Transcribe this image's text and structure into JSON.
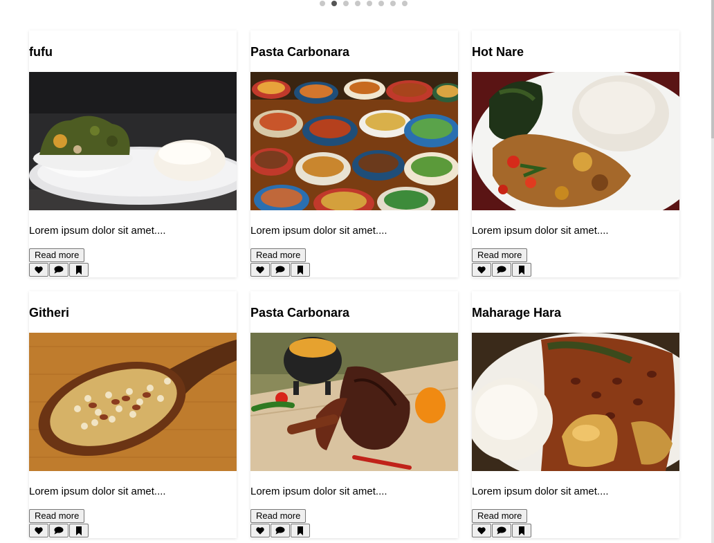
{
  "carousel": {
    "total": 8,
    "active_index": 1
  },
  "cards": [
    {
      "title": "fufu",
      "description": "Lorem ipsum dolor sit amet....",
      "read_more": "Read more",
      "image": "fufu-with-greens-photo"
    },
    {
      "title": "Pasta Carbonara",
      "description": "Lorem ipsum dolor sit amet....",
      "read_more": "Read more",
      "image": "african-food-spread-photo"
    },
    {
      "title": "Hot Nare",
      "description": "Lorem ipsum dolor sit amet....",
      "read_more": "Read more",
      "image": "ugali-stew-plate-photo"
    },
    {
      "title": "Githeri",
      "description": "Lorem ipsum dolor sit amet....",
      "read_more": "Read more",
      "image": "githeri-wooden-spoon-photo"
    },
    {
      "title": "Pasta Carbonara",
      "description": "Lorem ipsum dolor sit amet....",
      "read_more": "Read more",
      "image": "grilled-meat-board-photo"
    },
    {
      "title": "Maharage Hara",
      "description": "Lorem ipsum dolor sit amet....",
      "read_more": "Read more",
      "image": "ugali-beans-stew-photo"
    }
  ],
  "action_icons": [
    "heart-icon",
    "comment-icon",
    "bookmark-icon"
  ]
}
